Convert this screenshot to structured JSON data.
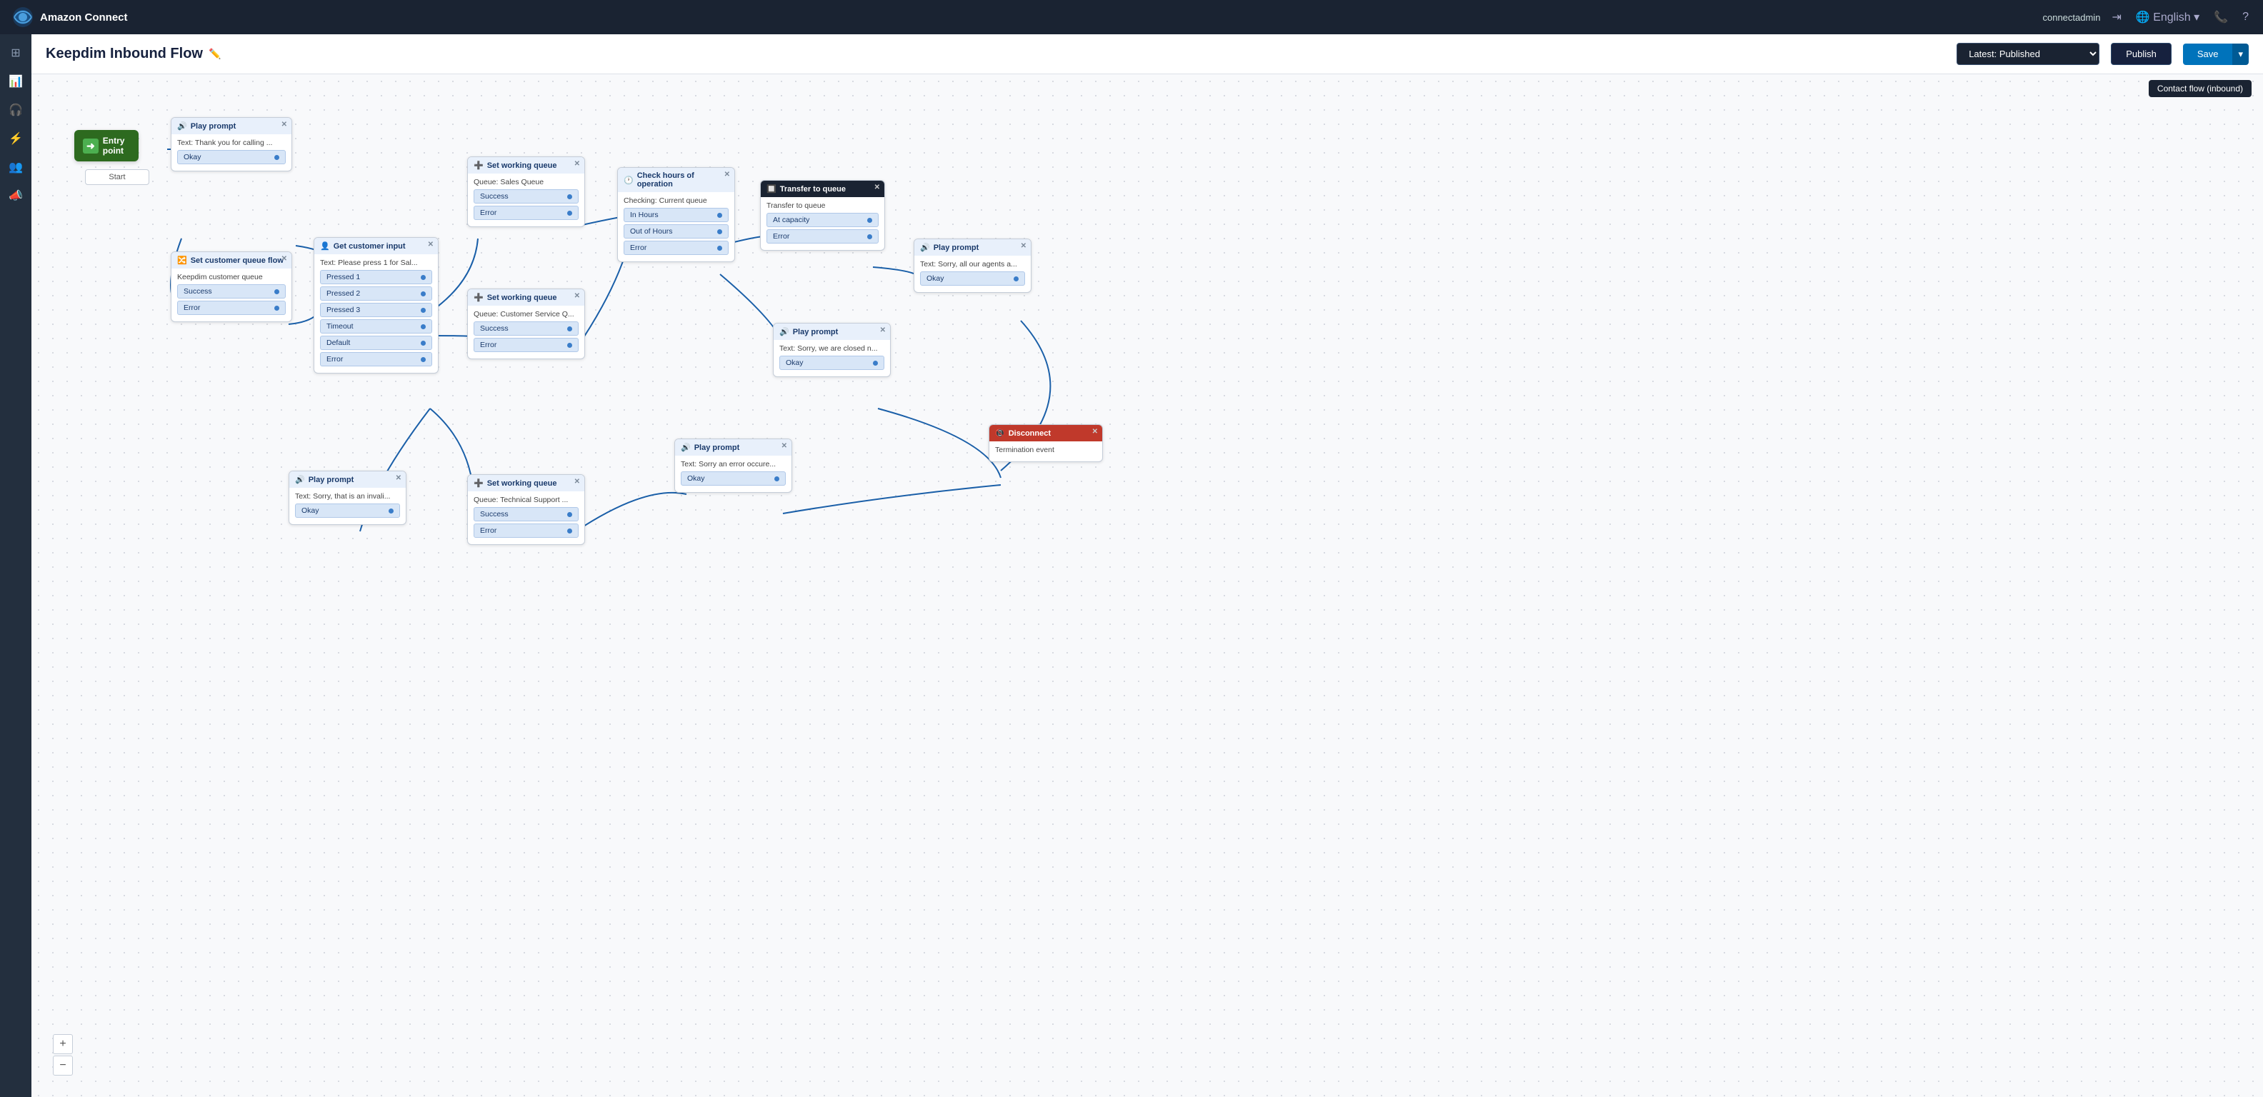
{
  "app": {
    "name": "Amazon Connect"
  },
  "header": {
    "title": "Keepdim Inbound Flow",
    "version_label": "Latest: Published",
    "publish_label": "Publish",
    "save_label": "Save",
    "flow_type": "Contact flow (inbound)"
  },
  "sidebar": {
    "items": [
      {
        "id": "grid",
        "icon": "⊞"
      },
      {
        "id": "chart",
        "icon": "📊"
      },
      {
        "id": "headset",
        "icon": "🎧"
      },
      {
        "id": "lightning",
        "icon": "⚡"
      },
      {
        "id": "people",
        "icon": "👥"
      },
      {
        "id": "megaphone",
        "icon": "📣"
      }
    ]
  },
  "nodes": {
    "entry": {
      "label": "Entry point",
      "start_label": "Start"
    },
    "play_prompt_1": {
      "title": "Play prompt",
      "text": "Text: Thank you for calling ...",
      "ports": [
        "Okay"
      ]
    },
    "set_customer_queue": {
      "title": "Set customer queue flow",
      "text": "Keepdim customer queue",
      "ports": [
        "Success",
        "Error"
      ]
    },
    "get_customer_input": {
      "title": "Get customer input",
      "text": "Text: Please press 1 for Sal...",
      "ports": [
        "Pressed 1",
        "Pressed 2",
        "Pressed 3",
        "Timeout",
        "Default",
        "Error"
      ]
    },
    "set_working_queue_1": {
      "title": "Set working queue",
      "text": "Queue: Sales Queue",
      "ports": [
        "Success",
        "Error"
      ]
    },
    "set_working_queue_2": {
      "title": "Set working queue",
      "text": "Queue: Customer Service Q...",
      "ports": [
        "Success",
        "Error"
      ]
    },
    "set_working_queue_3": {
      "title": "Set working queue",
      "text": "Queue: Technical Support ...",
      "ports": [
        "Success",
        "Error"
      ]
    },
    "check_hours": {
      "title": "Check hours of operation",
      "text": "Checking: Current queue",
      "ports": [
        "In Hours",
        "Out of Hours",
        "Error"
      ]
    },
    "transfer_to_queue": {
      "title": "Transfer to queue",
      "text": "Transfer to queue",
      "ports": [
        "At capacity",
        "Error"
      ]
    },
    "play_prompt_2": {
      "title": "Play prompt",
      "text": "Text: Sorry, all our agents a...",
      "ports": [
        "Okay"
      ]
    },
    "play_prompt_3": {
      "title": "Play prompt",
      "text": "Text: Sorry, we are closed n...",
      "ports": [
        "Okay"
      ]
    },
    "play_prompt_4": {
      "title": "Play prompt",
      "text": "Text: Sorry, that is an invali...",
      "ports": [
        "Okay"
      ]
    },
    "play_prompt_5": {
      "title": "Play prompt",
      "text": "Text: Sorry an error occure...",
      "ports": [
        "Okay"
      ]
    },
    "disconnect": {
      "title": "Disconnect",
      "text": "Termination event"
    }
  },
  "zoom": {
    "plus": "+",
    "minus": "−"
  }
}
